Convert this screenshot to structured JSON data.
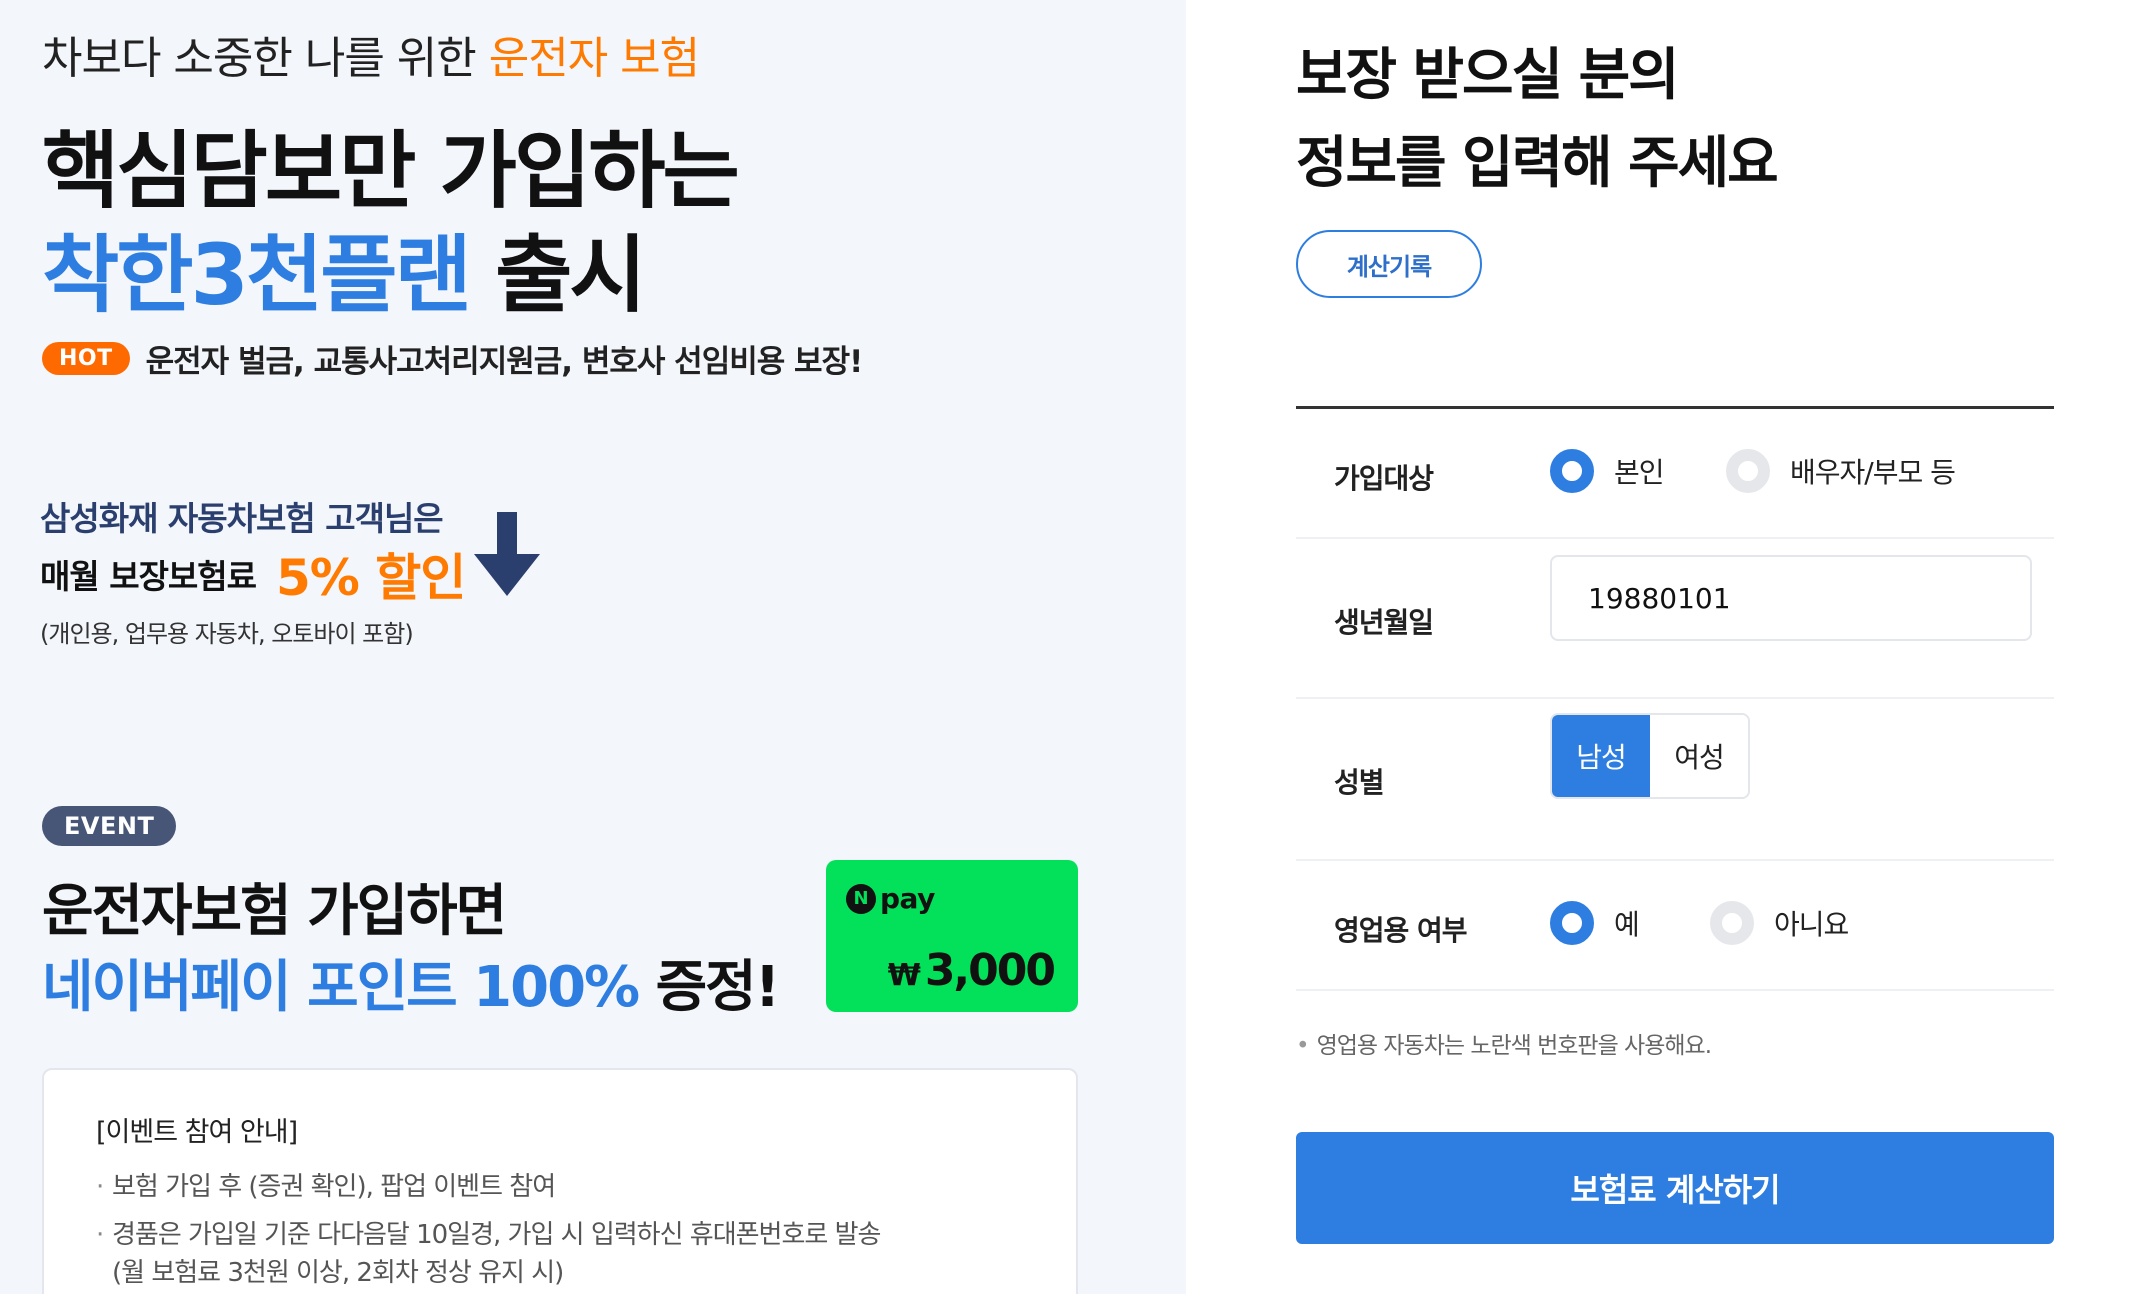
{
  "promo": {
    "eyebrow_prefix": "차보다 소중한 나를 위한 ",
    "eyebrow_highlight": "운전자 보험",
    "headline_line1": "핵심담보만 가입하는",
    "headline_blue": "착한3천플랜",
    "headline_suffix": " 출시",
    "hot_badge": "HOT",
    "hot_text": "운전자 벌금, 교통사고처리지원금, 변호사 선임비용 보장!",
    "accent_color": "#ff7a00",
    "brand_blue": "#2d7ee0"
  },
  "discount": {
    "line1": "삼성화재 자동차보험 고객님은",
    "line2_prefix": "매월 보장보험료",
    "line2_highlight": "5% 할인",
    "note": "(개인용, 업무용 자동차, 오토바이 포함)",
    "arrow_icon": "down-arrow-icon"
  },
  "event": {
    "badge": "EVENT",
    "line1": "운전자보험 가입하면",
    "line2_blue": "네이버페이 포인트 100%",
    "line2_suffix": " 증정!",
    "npay": {
      "logo_letter": "N",
      "logo_word": "pay",
      "currency": "₩",
      "amount": "3,000",
      "color": "#03e05a"
    },
    "info": {
      "title": "[이벤트 참여 안내]",
      "items": [
        "보험 가입 후 (증권 확인), 팝업 이벤트 참여",
        "경품은 가입일 기준 다다음달 10일경, 가입 시 입력하신 휴대폰번호로 발송"
      ],
      "sub_note": "(월 보험료 3천원 이상, 2회차 정상 유지 시)"
    }
  },
  "form": {
    "title_line1": "보장 받으실 분의",
    "title_line2": "정보를 입력해 주세요",
    "history_button": "계산기록",
    "target": {
      "label": "가입대상",
      "options": [
        "본인",
        "배우자/부모 등"
      ],
      "selected": "본인"
    },
    "dob": {
      "label": "생년월일",
      "value": "19880101"
    },
    "gender": {
      "label": "성별",
      "options": [
        "남성",
        "여성"
      ],
      "selected": "남성"
    },
    "business": {
      "label": "영업용 여부",
      "options": [
        "예",
        "아니요"
      ],
      "selected": "예"
    },
    "note": "영업용 자동차는 노란색 번호판을 사용해요.",
    "submit_button": "보험료 계산하기"
  }
}
